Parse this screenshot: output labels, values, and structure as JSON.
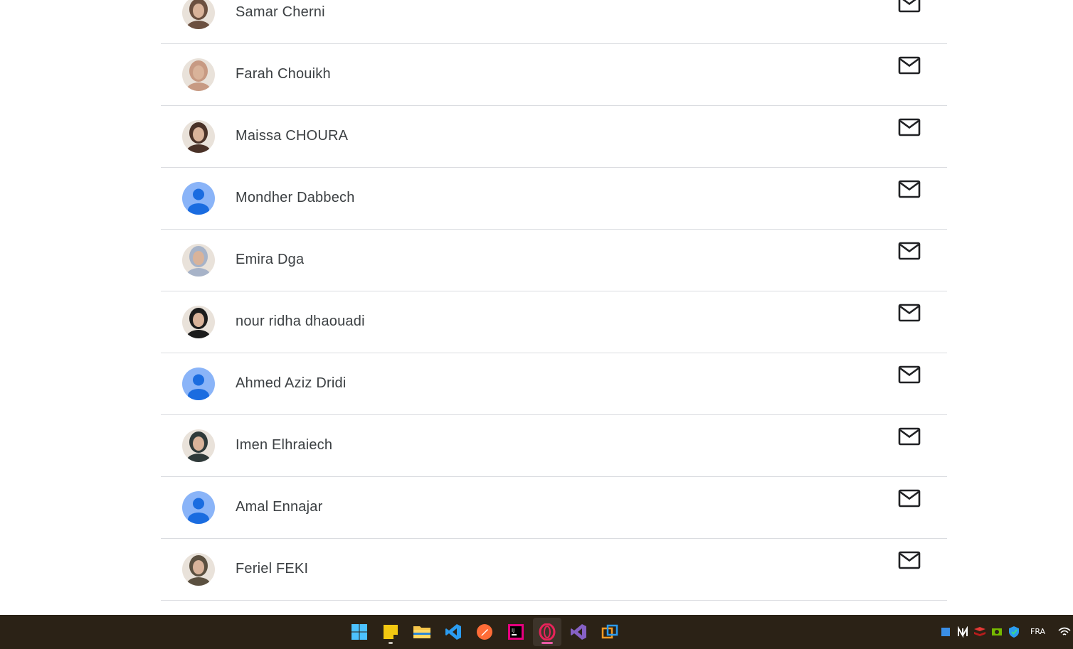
{
  "people": [
    {
      "name": "Samar Cherni",
      "avatar": "photo",
      "avatar_color": "#6b5040"
    },
    {
      "name": "Farah Chouikh",
      "avatar": "photo",
      "avatar_color": "#c79a83"
    },
    {
      "name": "Maissa CHOURA",
      "avatar": "photo",
      "avatar_color": "#4a3228"
    },
    {
      "name": "Mondher Dabbech",
      "avatar": "default",
      "avatar_color": "#8ab4f8"
    },
    {
      "name": "Emira Dga",
      "avatar": "photo",
      "avatar_color": "#a7b3c8"
    },
    {
      "name": "nour ridha dhaouadi",
      "avatar": "photo",
      "avatar_color": "#1c1c1c"
    },
    {
      "name": "Ahmed Aziz Dridi",
      "avatar": "default",
      "avatar_color": "#8ab4f8"
    },
    {
      "name": "Imen Elhraiech",
      "avatar": "photo",
      "avatar_color": "#2f3a3a"
    },
    {
      "name": "Amal Ennajar",
      "avatar": "default",
      "avatar_color": "#8ab4f8"
    },
    {
      "name": "Feriel FEKI",
      "avatar": "photo",
      "avatar_color": "#5b5040"
    }
  ],
  "mail_icon": "email-envelope-icon",
  "taskbar": {
    "apps": [
      {
        "name": "start-menu",
        "icon": "windows-logo-icon",
        "color": "#4cc2ff"
      },
      {
        "name": "sticky-notes",
        "icon": "sticky-notes-icon",
        "color": "#f2c811"
      },
      {
        "name": "file-explorer",
        "icon": "folder-icon",
        "color": "#f7c64a"
      },
      {
        "name": "vs-code",
        "icon": "vscode-icon",
        "color": "#2b9cf0"
      },
      {
        "name": "postman",
        "icon": "postman-icon",
        "color": "#ff6c37"
      },
      {
        "name": "intellij",
        "icon": "intellij-icon",
        "color": "#e6007e"
      },
      {
        "name": "opera",
        "icon": "opera-icon",
        "color": "#e8235a",
        "active": true
      },
      {
        "name": "visual-studio",
        "icon": "visual-studio-icon",
        "color": "#8661c5"
      },
      {
        "name": "remote-desktop",
        "icon": "windows-overlap-icon",
        "color": "#f59a23"
      }
    ],
    "tray": {
      "language": "FRA",
      "icons": [
        "blue-app-icon",
        "notion-like-icon",
        "redis-icon",
        "nvidia-icon",
        "security-shield-icon",
        "wifi-icon"
      ]
    }
  }
}
